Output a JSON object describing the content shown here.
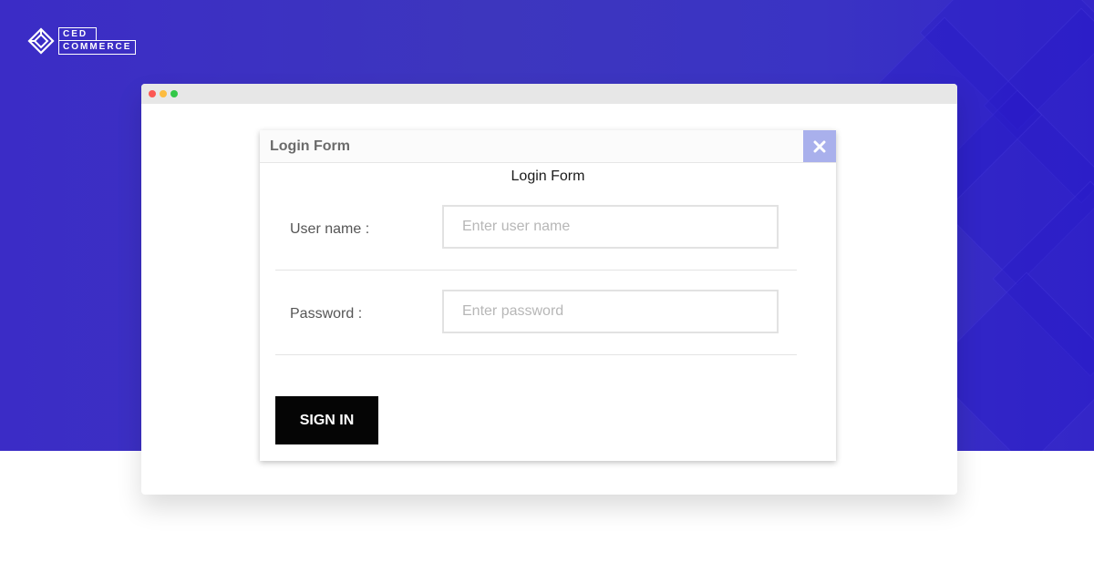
{
  "brand": {
    "line1": "CED",
    "line2": "COMMERCE",
    "logo_icon": "cedcommerce-logo-icon"
  },
  "browser": {
    "window_controls": [
      "close",
      "minimize",
      "maximize"
    ]
  },
  "modal": {
    "header_title": "Login Form",
    "close_icon": "close-icon",
    "form_heading": "Login Form",
    "username": {
      "label": "User name :",
      "placeholder": "Enter user name",
      "value": ""
    },
    "password": {
      "label": "Password :",
      "placeholder": "Enter password",
      "value": ""
    },
    "submit_label": "SIGN IN"
  },
  "colors": {
    "hero_background": "#3b30c4",
    "close_button": "#a9b0ec",
    "submit_button": "#050505"
  }
}
